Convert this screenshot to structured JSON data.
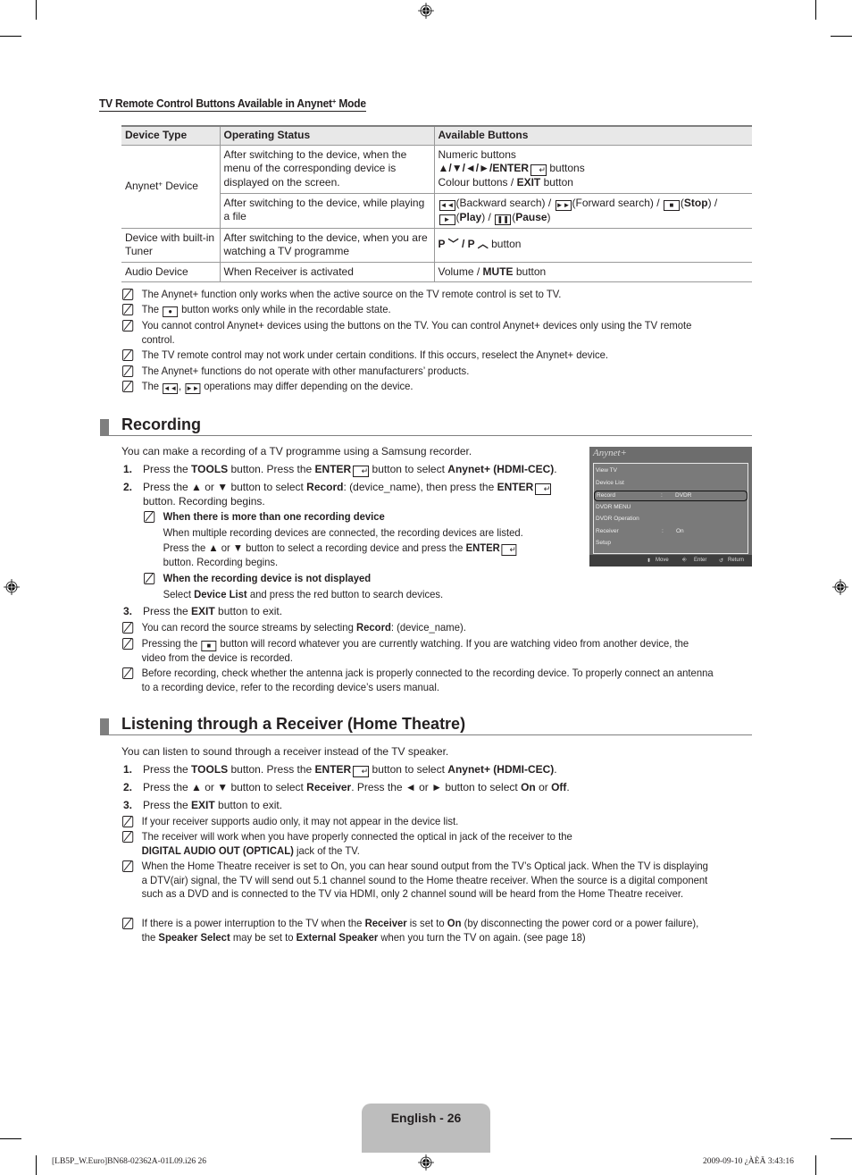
{
  "subheading": {
    "pre": "TV Remote Control Buttons Available in Anynet",
    "sup": "+",
    "post": " Mode"
  },
  "table": {
    "headers": [
      "Device Type",
      "Operating Status",
      "Available Buttons"
    ],
    "rows": [
      {
        "device": "Anynet",
        "device_sup": "+",
        "device_post": " Device",
        "status": "After switching to the device, when the menu of the corresponding device is displayed on the screen.",
        "buttons_l1": "Numeric buttons",
        "buttons_l2a": "▲/▼/◄/►/ENTER",
        "buttons_l2b": " buttons",
        "buttons_l3a": "Colour buttons / ",
        "buttons_l3b": "EXIT",
        "buttons_l3c": " button"
      },
      {
        "status": "After switching to the device, while playing a file",
        "b1": "(Backward search) / ",
        "b2": "(Forward search) / ",
        "b3": "(",
        "b3b": "Stop",
        "b3c": ") /",
        "b4": "(",
        "b4b": "Play",
        "b4c": ") / ",
        "b5": "(",
        "b5b": "Pause",
        "b5c": ")"
      },
      {
        "device": "Device with built-in Tuner",
        "status": "After switching to the device, when you are watching a TV programme",
        "buttons_a": "P ",
        "buttons_b": " / P ",
        "buttons_c": " button"
      },
      {
        "device": "Audio Device",
        "status": "When Receiver is activated",
        "buttons_a": "Volume / ",
        "buttons_b": "MUTE",
        "buttons_c": " button"
      }
    ]
  },
  "notes_top": [
    "The Anynet+ function only works when the active source on the TV remote control is set to TV.",
    "button works only while in the recordable state.",
    "You cannot control Anynet+ devices using the buttons on the TV. You can control Anynet+ devices only using the TV remote control.",
    "The TV remote control may not work under certain conditions. If this occurs, reselect the Anynet+ device.",
    "The Anynet+ functions do not operate with other manufacturers’ products.",
    "operations may differ depending on the device."
  ],
  "recording": {
    "title": "Recording",
    "intro": "You can make a recording of a TV programme using a Samsung recorder.",
    "step1": {
      "n": "1.",
      "a": "Press the ",
      "b": "TOOLS",
      "c": " button. Press the ",
      "d": "ENTER",
      "e": " button to select ",
      "f": "Anynet+ (HDMI-CEC)",
      "g": "."
    },
    "step2": {
      "n": "2.",
      "a": "Press the ▲ or ▼ button to select ",
      "b": "Record",
      "c": ": (device_name), then press the ",
      "d": "ENTER",
      "e": " button. Recording begins."
    },
    "sub1": {
      "title": "When there is more than one recording device",
      "l1": "When multiple recording devices are connected, the recording devices are listed.",
      "l2a": "Press the ▲ or ▼ button to select a recording device and press the ",
      "l2b": "ENTER",
      "l2c": " button. Recording begins."
    },
    "sub2": {
      "title": "When the recording device is not displayed",
      "a": "Select ",
      "b": "Device List",
      "c": " and press the red button to search devices."
    },
    "step3": {
      "n": "3.",
      "a": "Press the ",
      "b": "EXIT",
      "c": " button to exit."
    },
    "notes": [
      {
        "a": "You can record the source streams by selecting ",
        "b": "Record",
        "c": ": (device_name)."
      },
      {
        "a": "Pressing the ",
        "c": " button will record whatever you are currently watching. If you are watching video from another device, the video from the device is recorded."
      },
      {
        "a": "Before recording, check whether the antenna jack is properly connected to the recording device. To properly connect an antenna to a recording device, refer to the recording device’s users manual."
      }
    ]
  },
  "osd": {
    "logo": "Anynet+",
    "items": [
      {
        "label": "View TV"
      },
      {
        "label": "Device List"
      },
      {
        "label": "Record",
        "colon": ":",
        "value": "DVDR"
      },
      {
        "label": "DVDR MENU"
      },
      {
        "label": "DVDR Operation"
      },
      {
        "label": "Receiver",
        "colon": ":",
        "value": "On"
      },
      {
        "label": "Setup"
      }
    ],
    "footer": {
      "move": "Move",
      "enter": "Enter",
      "return": "Return"
    }
  },
  "receiver": {
    "title": "Listening through a Receiver (Home Theatre)",
    "intro": "You can listen to sound through a receiver instead of the TV speaker.",
    "step1": {
      "n": "1.",
      "a": "Press the ",
      "b": "TOOLS",
      "c": " button. Press the ",
      "d": "ENTER",
      "e": " button to select ",
      "f": "Anynet+ (HDMI-CEC)",
      "g": "."
    },
    "step2": {
      "n": "2.",
      "a": "Press the ▲ or ▼ button to select ",
      "b": "Receiver",
      "c": ". Press the ◄ or ► button to select ",
      "d": "On",
      "e": " or ",
      "f": "Off",
      "g": "."
    },
    "step3": {
      "n": "3.",
      "a": "Press the ",
      "b": "EXIT",
      "c": " button to exit."
    },
    "notes": [
      {
        "a": "If your receiver supports audio only, it may not appear in the device list."
      },
      {
        "a": "The receiver will work when you have properly connected the optical in jack of the receiver to the ",
        "b": "DIGITAL AUDIO OUT (OPTICAL)",
        "c": " jack of the TV."
      },
      {
        "a": "When the Home Theatre receiver is set to On, you can hear sound output from the TV’s Optical jack. When the TV is displaying a DTV(air) signal, the TV will send out 5.1 channel sound to the Home theatre receiver. When the source is a digital component such as a DVD and is connected to the TV via HDMI, only 2 channel sound will be heard from the Home Theatre receiver."
      },
      {
        "a": "If there is a power interruption to the TV when the ",
        "b": "Receiver",
        "c": " is set to ",
        "d": "On",
        "e": " (by disconnecting the power cord or a power failure), the ",
        "f": "Speaker Select",
        "g": " may be set to ",
        "h": "External Speaker",
        "i": " when you turn the TV on again. (see page 18)"
      }
    ]
  },
  "footer": {
    "page_label": "English - 26",
    "slug_left": "[LB5P_W.Euro]BN68-02362A-01L09.i26   26",
    "slug_right": "2009-09-10   ¿ÀÈÄ 3:43:16"
  }
}
